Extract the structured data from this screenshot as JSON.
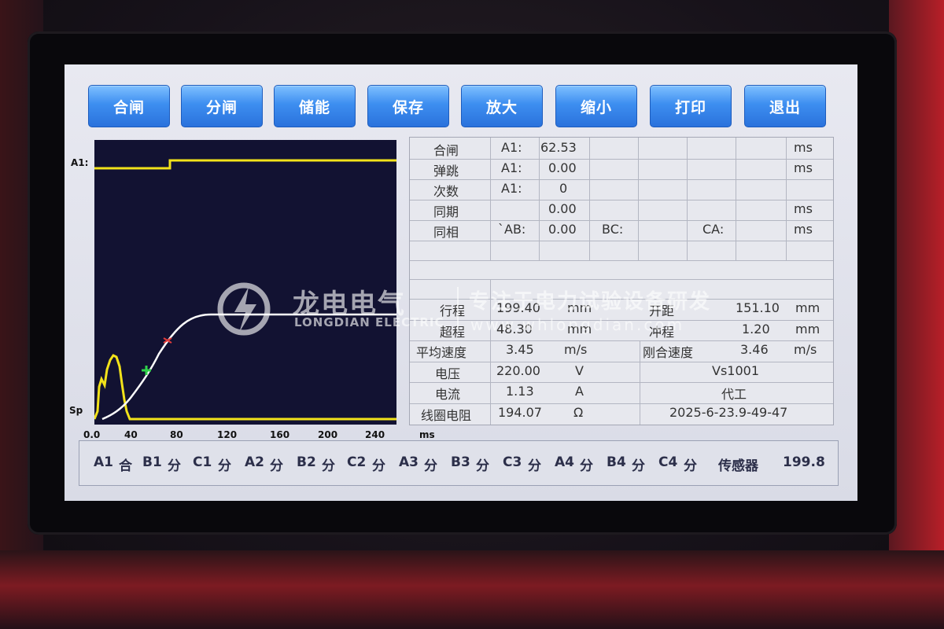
{
  "toolbar": {
    "buttons": [
      "合闸",
      "分闸",
      "储能",
      "保存",
      "放大",
      "缩小",
      "打印",
      "退出"
    ]
  },
  "waveform": {
    "label_top": "A1:",
    "label_bottom": "Sp",
    "x_ticks": [
      "0.0",
      "40",
      "80",
      "120",
      "160",
      "200",
      "240"
    ],
    "x_unit": "ms",
    "colors": {
      "background": "#121232",
      "contact_trace": "#f2e21a",
      "travel_curve": "#ffffff",
      "marker_open": "#e33b3b",
      "marker_close": "#2fd34a"
    }
  },
  "results": {
    "rows": [
      [
        "合闸",
        "A1:",
        "62.53",
        "ms"
      ],
      [
        "弹跳",
        "A1:",
        "0.00",
        "ms"
      ],
      [
        "次数",
        "A1:",
        "0"
      ],
      [
        "同期",
        "0.00",
        "ms"
      ],
      [
        "同相",
        "`AB:",
        "0.00",
        "BC:",
        "CA:",
        "ms"
      ]
    ],
    "motion": [
      [
        "行程",
        "199.40",
        "mm",
        "开距",
        "151.10",
        "mm"
      ],
      [
        "超程",
        "48.30",
        "mm",
        "冲程",
        "1.20",
        "mm"
      ],
      [
        "平均速度",
        "3.45",
        "m/s",
        "刚合速度",
        "3.46",
        "m/s"
      ]
    ],
    "electrical": [
      [
        "电压",
        "220.00",
        "V",
        "Vs1001"
      ],
      [
        "电流",
        "1.13",
        "A",
        "代工"
      ],
      [
        "线圈电阻",
        "194.07",
        "Ω",
        "2025-6-23.9-49-47"
      ]
    ]
  },
  "statusbar": {
    "items": [
      "A1",
      "合",
      "B1",
      "分",
      "C1",
      "分",
      "A2",
      "分",
      "B2",
      "分",
      "C2",
      "分",
      "A3",
      "分",
      "B3",
      "分",
      "C3",
      "分",
      "A4",
      "分",
      "B4",
      "分",
      "C4",
      "分",
      "传感器",
      "199.8"
    ]
  },
  "watermark": {
    "brand": "龙电电气",
    "brand_en": "LONGDIAN ELECTRIC",
    "slogan": "专注于电力试验设备研发",
    "url": "www.whlongdian.com"
  }
}
